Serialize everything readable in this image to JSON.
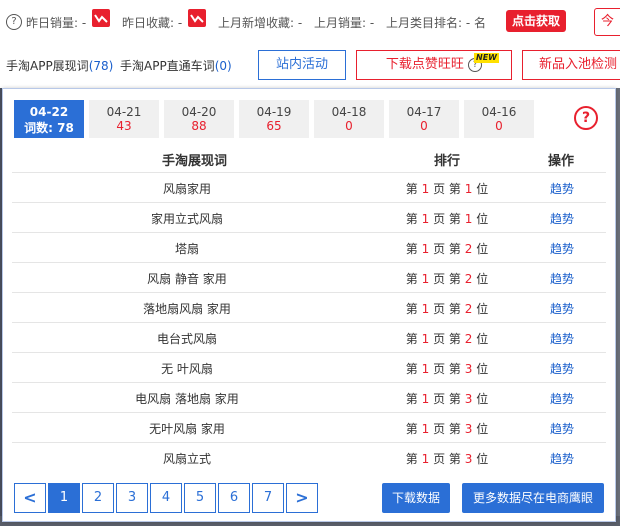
{
  "topbar": {
    "help": "?",
    "stats": [
      {
        "label": "昨日销量: -"
      },
      {
        "label": "昨日收藏: -"
      },
      {
        "label": "上月新增收藏: -"
      },
      {
        "label": "上月销量: -"
      },
      {
        "label": "上月类目排名: - 名"
      }
    ],
    "get_button": "点击获取",
    "today_button": "今"
  },
  "row2": {
    "tab_exposure": "手淘APP展现词",
    "tab_exposure_count": "(78)",
    "tab_direct": "手淘APP直通车词",
    "tab_direct_count": "(0)",
    "btn_activity": "站内活动",
    "btn_download_zan": "下载点赞旺旺",
    "btn_download_help": "?",
    "new_badge": "NEW",
    "btn_new_product": "新品入池检测"
  },
  "panel": {
    "date_tabs": [
      {
        "date": "04-22",
        "count": "词数: 78",
        "active": true
      },
      {
        "date": "04-21",
        "count": "43"
      },
      {
        "date": "04-20",
        "count": "88"
      },
      {
        "date": "04-19",
        "count": "65"
      },
      {
        "date": "04-18",
        "count": "0"
      },
      {
        "date": "04-17",
        "count": "0"
      },
      {
        "date": "04-16",
        "count": "0"
      }
    ],
    "help": "?",
    "headers": {
      "keyword": "手淘展现词",
      "rank": "排行",
      "action": "操作"
    },
    "rows": [
      {
        "keyword": "风扇家用",
        "page": "1",
        "pos": "1",
        "action": "趋势"
      },
      {
        "keyword": "家用立式风扇",
        "page": "1",
        "pos": "1",
        "action": "趋势"
      },
      {
        "keyword": "塔扇",
        "page": "1",
        "pos": "2",
        "action": "趋势"
      },
      {
        "keyword": "风扇 静音 家用",
        "page": "1",
        "pos": "2",
        "action": "趋势"
      },
      {
        "keyword": "落地扇风扇 家用",
        "page": "1",
        "pos": "2",
        "action": "趋势"
      },
      {
        "keyword": "电台式风扇",
        "page": "1",
        "pos": "2",
        "action": "趋势"
      },
      {
        "keyword": "无 叶风扇",
        "page": "1",
        "pos": "3",
        "action": "趋势"
      },
      {
        "keyword": "电风扇 落地扇 家用",
        "page": "1",
        "pos": "3",
        "action": "趋势"
      },
      {
        "keyword": "无叶风扇 家用",
        "page": "1",
        "pos": "3",
        "action": "趋势"
      },
      {
        "keyword": "风扇立式",
        "page": "1",
        "pos": "3",
        "action": "趋势"
      }
    ],
    "rank_labels": {
      "page_prefix": "第",
      "page_suffix": "页",
      "pos_prefix": "第",
      "pos_suffix": "位"
    },
    "pagination": {
      "prev": "<",
      "pages": [
        "1",
        "2",
        "3",
        "4",
        "5",
        "6",
        "7"
      ],
      "next": ">",
      "current": "1"
    },
    "download_button": "下载数据",
    "more_button": "更多数据尽在电商鹰眼"
  },
  "colors": {
    "accent": "#2b6fd6",
    "red": "#e8202e"
  }
}
